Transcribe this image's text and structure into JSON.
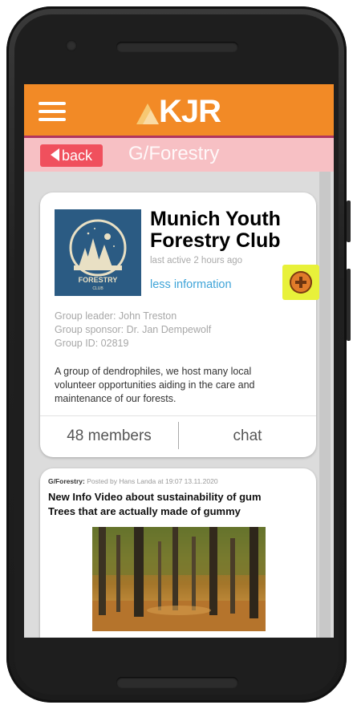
{
  "app": {
    "logo_text": "KJR",
    "accent_color": "#f28a26",
    "subbar_color": "#f7c0c4"
  },
  "nav": {
    "back_label": "back",
    "title": "G/Forestry"
  },
  "group": {
    "name": "Munich Youth Forestry Club",
    "last_active": "last active 2 hours ago",
    "toggle_info": "less information",
    "leader": "Group leader: John Treston",
    "sponsor": "Group sponsor: Dr. Jan Dempewolf",
    "group_id": "Group ID: 02819",
    "description": "A group of dendrophiles, we host many local volunteer opportunities aiding in the care and maintenance of our forests.",
    "members_label": "48 members",
    "chat_label": "chat",
    "logo_line1": "FORESTRY",
    "logo_line2": "CLUB"
  },
  "post": {
    "group_tag": "G/Forestry:",
    "byline": "Posted by Hans Landa at 19:07 13.11.2020",
    "title": "New Info Video about sustainability of gum Trees that are actually made of gummy"
  }
}
